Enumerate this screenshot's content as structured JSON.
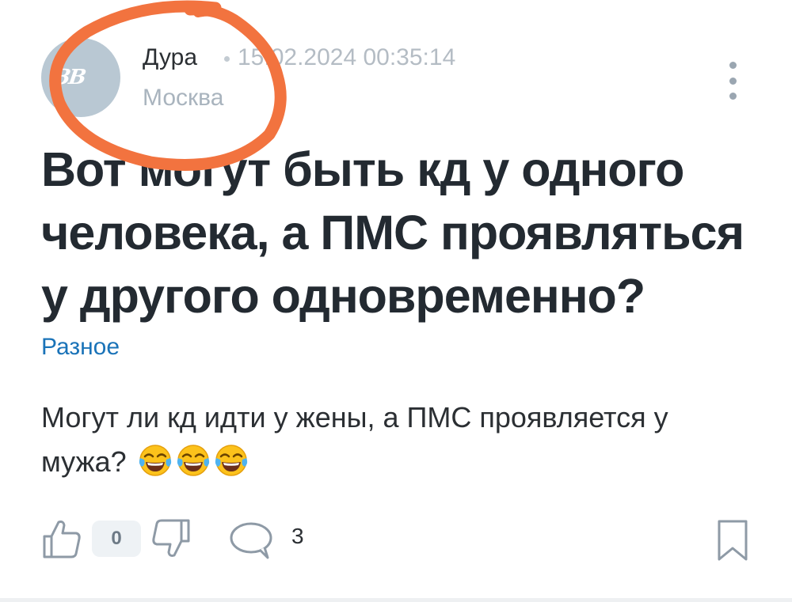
{
  "post": {
    "author": {
      "name": "Дура",
      "city": "Москва",
      "avatar_initials": "ЗВ"
    },
    "date": "15.02.2024 00:35:14",
    "title": "Вот могут быть кд у одного человека, а ПМС проявляться у другого одновременно?",
    "category": "Разное",
    "body": "Могут ли кд идти у жены, а ПМС проявляется у мужа?",
    "emoji_names": [
      "face-with-tears-of-joy",
      "face-with-tears-of-joy",
      "face-with-tears-of-joy"
    ]
  },
  "actions": {
    "likes": "0",
    "comments": "3"
  },
  "icons": {
    "like": "thumbs-up-icon",
    "dislike": "thumbs-down-icon",
    "comment": "speech-bubble-icon",
    "bookmark": "bookmark-icon",
    "more": "vertical-dots-icon"
  },
  "colors": {
    "link": "#1a73b8",
    "annotation": "#f2733f",
    "avatar_bg": "#b9c8d3"
  }
}
